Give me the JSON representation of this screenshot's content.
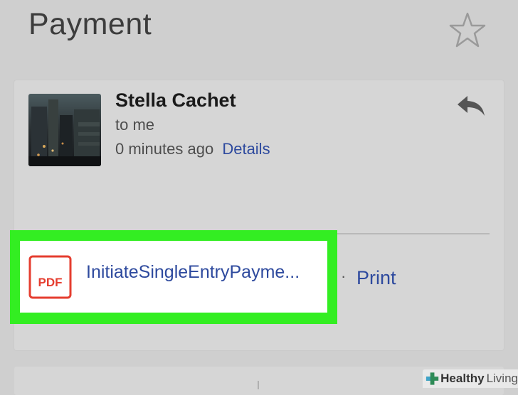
{
  "header": {
    "title": "Payment",
    "star_icon": "star-outline-icon"
  },
  "message": {
    "sender": "Stella Cachet",
    "recipient": "to me",
    "timestamp": "0 minutes ago",
    "details_label": "Details",
    "reply_icon": "reply-icon"
  },
  "attachment": {
    "icon": "pdf-icon",
    "icon_label": "PDF",
    "filename": "InitiateSingleEntryPayme...",
    "highlight_color": "#33ee22"
  },
  "actions": {
    "separator": "·",
    "print_label": "Print"
  },
  "watermark": {
    "brand_bold": "Healthy",
    "brand_light": "Living"
  },
  "colors": {
    "link": "#2e4a9e",
    "pdf_red": "#e53d2f",
    "background": "#cfcfcf"
  }
}
